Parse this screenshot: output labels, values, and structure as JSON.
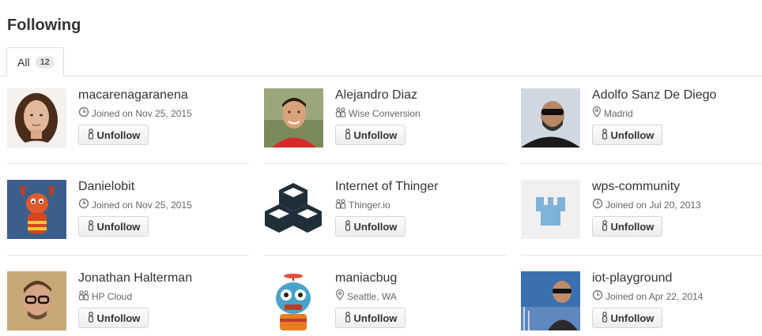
{
  "header": {
    "title": "Following"
  },
  "tabs": [
    {
      "label": "All",
      "count": "12"
    }
  ],
  "button_label": "Unfollow",
  "users": [
    {
      "name": "macarenagaranena",
      "meta": "Joined on Nov 25, 2015",
      "meta_icon": "clock-icon"
    },
    {
      "name": "Alejandro Diaz",
      "meta": "Wise Conversion",
      "meta_icon": "organization-icon"
    },
    {
      "name": "Adolfo Sanz De Diego",
      "meta": "Madrid",
      "meta_icon": "location-icon"
    },
    {
      "name": "Danielobit",
      "meta": "Joined on Nov 25, 2015",
      "meta_icon": "clock-icon"
    },
    {
      "name": "Internet of Thinger",
      "meta": "Thinger.io",
      "meta_icon": "organization-icon"
    },
    {
      "name": "wps-community",
      "meta": "Joined on Jul 20, 2013",
      "meta_icon": "clock-icon"
    },
    {
      "name": "Jonathan Halterman",
      "meta": "HP Cloud",
      "meta_icon": "organization-icon"
    },
    {
      "name": "maniacbug",
      "meta": "Seattle, WA",
      "meta_icon": "location-icon"
    },
    {
      "name": "iot-playground",
      "meta": "Joined on Apr 22, 2014",
      "meta_icon": "clock-icon"
    }
  ]
}
